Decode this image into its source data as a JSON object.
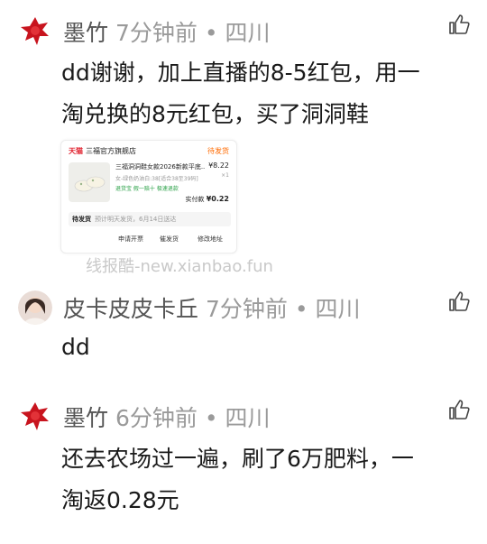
{
  "comments": [
    {
      "username": "墨竹",
      "time_location": "7分钟前 • 四川",
      "lines": [
        "dd谢谢，加上直播的8-5红包，用一",
        "淘兑换的8元红包，买了洞洞鞋"
      ],
      "avatar": "red-flower-avatar"
    },
    {
      "username": "皮卡皮皮卡丘",
      "time_location": "7分钟前 • 四川",
      "lines": [
        "dd"
      ],
      "avatar": "girl-photo-avatar"
    },
    {
      "username": "墨竹",
      "time_location": "6分钟前 • 四川",
      "lines": [
        "还去农场过一遍，刷了6万肥料，一",
        "淘返0.28元"
      ],
      "avatar": "red-flower-avatar"
    }
  ],
  "order": {
    "platform": "天猫",
    "shop": "三福官方旗舰店",
    "status": "待发货",
    "title": "三福洞洞鞋女款2026新款平底...",
    "price": "¥8.22",
    "qty": "×1",
    "sku": "女-绿色奶油白:38[适合38至39码]",
    "tags": "退货宝  假一赔十  极速退款",
    "paid_label": "实付款",
    "paid_value": "¥0.22",
    "ship_label": "待发货",
    "ship_estimate": "预计明天发货，6月14日送达",
    "buttons": [
      "申请开票",
      "催发货",
      "修改地址"
    ]
  },
  "watermark": "线报酷-new.xianbao.fun",
  "icons": {
    "like": "thumbs-up-icon"
  }
}
